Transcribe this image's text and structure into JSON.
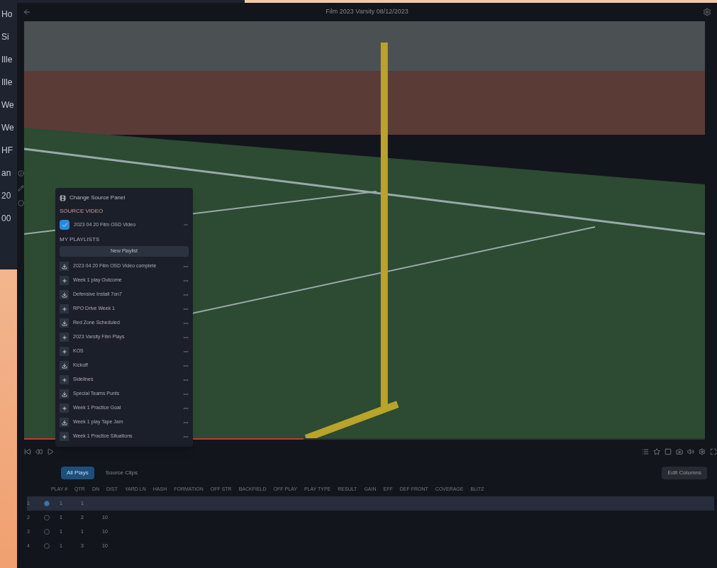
{
  "background_window": {
    "items": [
      "Ho",
      "Si",
      "Ille",
      "Ille",
      "We",
      "We",
      "HF",
      "an",
      "20",
      "00"
    ]
  },
  "window": {
    "title": "Film 2023 Varsity 08/12/2023"
  },
  "source_panel": {
    "title": "Change Source Panel",
    "source_label": "SOURCE VIDEO",
    "source": {
      "label": "2023 04 20 Film OSD Video",
      "checked": true
    },
    "playlists_label": "MY PLAYLISTS",
    "new_button": "New Playlist",
    "playlists": [
      {
        "kind": "download",
        "label": "2023 04 20 Film OSD Video complete"
      },
      {
        "kind": "add",
        "label": "Week 1 play Outcome"
      },
      {
        "kind": "download",
        "label": "Defensive Install 7on7"
      },
      {
        "kind": "add",
        "label": "RPO Drive Week 1"
      },
      {
        "kind": "download",
        "label": "Red Zone Scheduled"
      },
      {
        "kind": "add",
        "label": "2023 Varsity Film Plays"
      },
      {
        "kind": "add",
        "label": "KOS"
      },
      {
        "kind": "download",
        "label": "Kickoff"
      },
      {
        "kind": "add",
        "label": "Sidelines"
      },
      {
        "kind": "download",
        "label": "Special Teams Punts"
      },
      {
        "kind": "add",
        "label": "Week 1 Practice Goal"
      },
      {
        "kind": "download",
        "label": "Week 1 play Tape Jam"
      },
      {
        "kind": "add",
        "label": "Week 1 Practice Situations"
      }
    ]
  },
  "playback": {
    "level": 0.41
  },
  "tabs": [
    {
      "label": "All Plays",
      "selected": true
    },
    {
      "label": "Source Clips",
      "selected": false
    }
  ],
  "edit_button": "Edit Columns",
  "table": {
    "columns": [
      "PLAY #",
      "QTR",
      "DN",
      "DIST",
      "YARD LN",
      "HASH",
      "FORMATION",
      "OFF STR",
      "BACKFIELD",
      "OFF PLAY",
      "PLAY TYPE",
      "RESULT",
      "GAIN",
      "EFF",
      "DEF FRONT",
      "COVERAGE",
      "BLITZ"
    ],
    "rows": [
      {
        "number": "1",
        "selected": true,
        "cells": [
          "1",
          "1"
        ]
      },
      {
        "number": "2",
        "selected": false,
        "cells": [
          "1",
          "2",
          "10"
        ]
      },
      {
        "number": "3",
        "selected": false,
        "cells": [
          "1",
          "1",
          "10"
        ]
      },
      {
        "number": "4",
        "selected": false,
        "cells": [
          "1",
          "3",
          "10"
        ]
      }
    ]
  }
}
